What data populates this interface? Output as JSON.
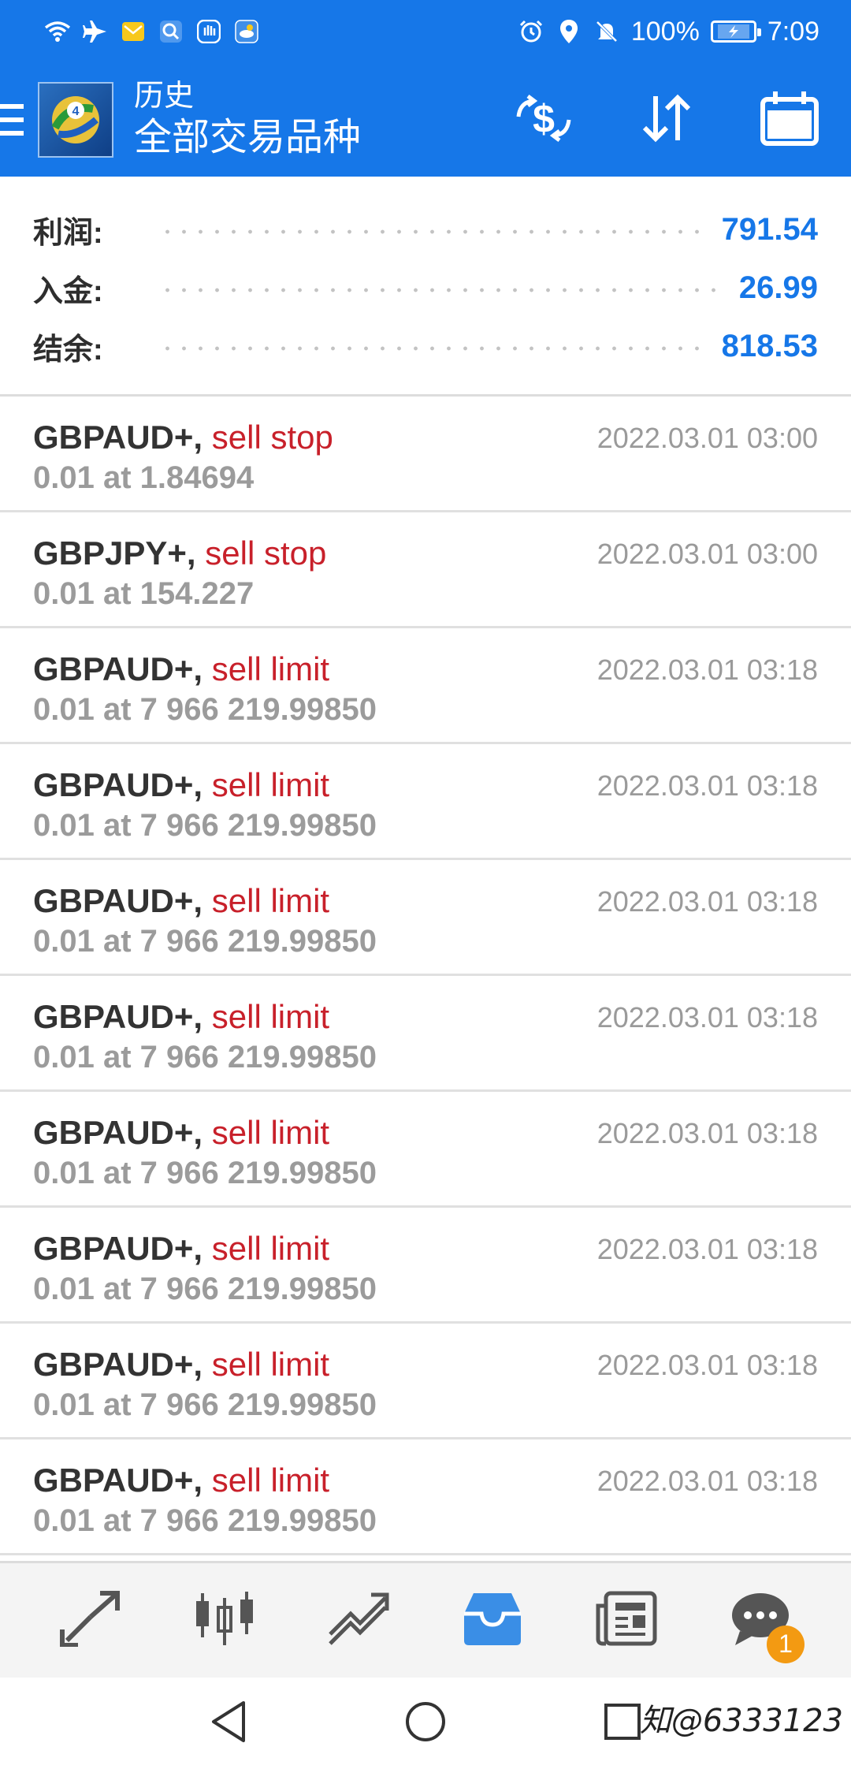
{
  "status_bar": {
    "battery_percent": "100%",
    "time": "7:09"
  },
  "app_bar": {
    "title": "历史",
    "subtitle": "全部交易品种"
  },
  "summary": [
    {
      "label": "利润:",
      "value": "791.54"
    },
    {
      "label": "入金:",
      "value": "26.99"
    },
    {
      "label": "结余:",
      "value": "818.53"
    }
  ],
  "orders": [
    {
      "symbol": "GBPAUD+,",
      "type": "sell stop",
      "detail": "0.01 at 1.84694",
      "time": "2022.03.01 03:00"
    },
    {
      "symbol": "GBPJPY+,",
      "type": "sell stop",
      "detail": "0.01 at 154.227",
      "time": "2022.03.01 03:00"
    },
    {
      "symbol": "GBPAUD+,",
      "type": "sell limit",
      "detail": "0.01 at 7 966 219.99850",
      "time": "2022.03.01 03:18"
    },
    {
      "symbol": "GBPAUD+,",
      "type": "sell limit",
      "detail": "0.01 at 7 966 219.99850",
      "time": "2022.03.01 03:18"
    },
    {
      "symbol": "GBPAUD+,",
      "type": "sell limit",
      "detail": "0.01 at 7 966 219.99850",
      "time": "2022.03.01 03:18"
    },
    {
      "symbol": "GBPAUD+,",
      "type": "sell limit",
      "detail": "0.01 at 7 966 219.99850",
      "time": "2022.03.01 03:18"
    },
    {
      "symbol": "GBPAUD+,",
      "type": "sell limit",
      "detail": "0.01 at 7 966 219.99850",
      "time": "2022.03.01 03:18"
    },
    {
      "symbol": "GBPAUD+,",
      "type": "sell limit",
      "detail": "0.01 at 7 966 219.99850",
      "time": "2022.03.01 03:18"
    },
    {
      "symbol": "GBPAUD+,",
      "type": "sell limit",
      "detail": "0.01 at 7 966 219.99850",
      "time": "2022.03.01 03:18"
    },
    {
      "symbol": "GBPAUD+,",
      "type": "sell limit",
      "detail": "0.01 at 7 966 219.99850",
      "time": "2022.03.01 03:18"
    }
  ],
  "bottom_nav": {
    "chat_badge": "1"
  },
  "watermark": "知@6333123",
  "colors": {
    "primary": "#1677e8",
    "sell": "#c8202a",
    "muted": "#9b9b9b",
    "badge": "#f39a12"
  },
  "icons": [
    "wifi-icon",
    "airplane-icon",
    "mail-icon",
    "search-icon",
    "hand-icon",
    "weather-icon",
    "alarm-icon",
    "location-icon",
    "mute-icon",
    "battery-icon",
    "menu-icon",
    "metatrader-logo",
    "currency-exchange-icon",
    "sort-icon",
    "calendar-icon",
    "quotes-icon",
    "chart-icon",
    "trade-icon",
    "history-icon",
    "news-icon",
    "chat-icon",
    "back-icon",
    "home-icon",
    "recents-icon"
  ]
}
